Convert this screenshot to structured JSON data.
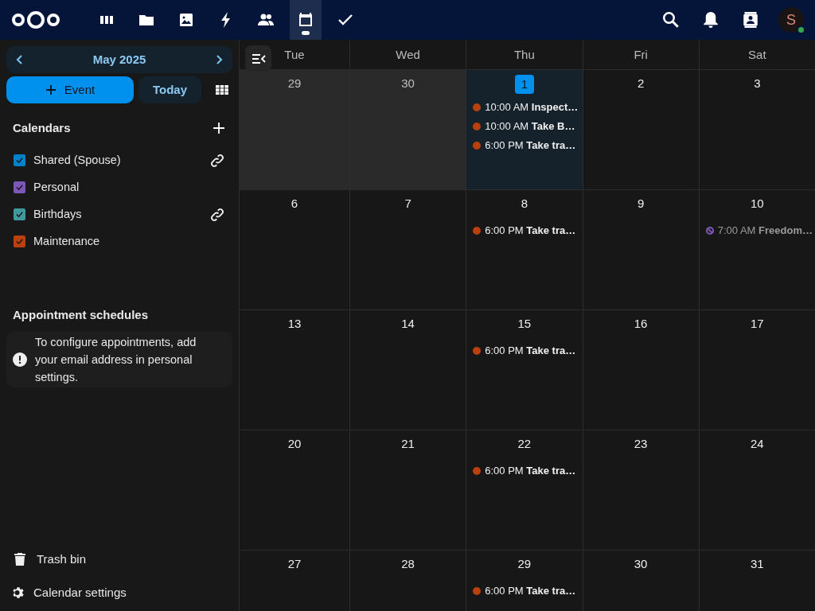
{
  "top_bar": {
    "apps": [
      {
        "kind": "dashboard",
        "selected": false
      },
      {
        "kind": "files",
        "selected": false
      },
      {
        "kind": "photos",
        "selected": false
      },
      {
        "kind": "activity",
        "selected": false
      },
      {
        "kind": "contacts",
        "selected": false
      },
      {
        "kind": "calendar",
        "selected": true
      },
      {
        "kind": "tasks",
        "selected": false
      }
    ],
    "avatar": "S"
  },
  "sidebar": {
    "month": "May 2025",
    "new_event": "Event",
    "today": "Today",
    "calendars_heading": "Calendars",
    "calendars": [
      {
        "name": "Shared (Spouse)",
        "color": "#0082c9",
        "checked": true,
        "shared": true
      },
      {
        "name": "Personal",
        "color": "#7b58b5",
        "checked": true,
        "shared": false
      },
      {
        "name": "Birthdays",
        "color": "#3e9a9c",
        "checked": true,
        "shared": true
      },
      {
        "name": "Maintenance",
        "color": "#b9400f",
        "checked": true,
        "shared": false
      }
    ],
    "appointments_heading": "Appointment schedules",
    "appointments_notice": "To configure appointments, add your email address in personal settings.",
    "trash": "Trash bin",
    "settings": "Calendar settings"
  },
  "calendar": {
    "columns": [
      "Tue",
      "Wed",
      "Thu",
      "Fri",
      "Sat"
    ],
    "weeks": [
      [
        {
          "day": "29",
          "other_month": true,
          "today": false
        },
        {
          "day": "30",
          "other_month": true,
          "today": false
        },
        {
          "day": "1",
          "other_month": false,
          "today": true,
          "events": [
            {
              "time": "10:00 AM",
              "title": "Inspect…",
              "color": "#b9400f",
              "kind": "normal"
            },
            {
              "time": "10:00 AM",
              "title": "Take B…",
              "color": "#b9400f",
              "kind": "normal"
            },
            {
              "time": "6:00 PM",
              "title": "Take tra…",
              "color": "#b9400f",
              "kind": "normal"
            }
          ]
        },
        {
          "day": "2",
          "other_month": false,
          "today": false
        },
        {
          "day": "3",
          "other_month": false,
          "today": false
        }
      ],
      [
        {
          "day": "6",
          "other_month": false,
          "today": false
        },
        {
          "day": "7",
          "other_month": false,
          "today": false
        },
        {
          "day": "8",
          "other_month": false,
          "today": false,
          "events": [
            {
              "time": "6:00 PM",
              "title": "Take tra…",
              "color": "#b9400f",
              "kind": "normal"
            }
          ]
        },
        {
          "day": "9",
          "other_month": false,
          "today": false
        },
        {
          "day": "10",
          "other_month": false,
          "today": false,
          "events": [
            {
              "time": "7:00 AM",
              "title": "Freedom…",
              "color": "#7b58b5",
              "kind": "cancelled"
            }
          ]
        }
      ],
      [
        {
          "day": "13",
          "other_month": false,
          "today": false
        },
        {
          "day": "14",
          "other_month": false,
          "today": false
        },
        {
          "day": "15",
          "other_month": false,
          "today": false,
          "events": [
            {
              "time": "6:00 PM",
              "title": "Take tra…",
              "color": "#b9400f",
              "kind": "normal"
            }
          ]
        },
        {
          "day": "16",
          "other_month": false,
          "today": false
        },
        {
          "day": "17",
          "other_month": false,
          "today": false
        }
      ],
      [
        {
          "day": "20",
          "other_month": false,
          "today": false
        },
        {
          "day": "21",
          "other_month": false,
          "today": false
        },
        {
          "day": "22",
          "other_month": false,
          "today": false,
          "events": [
            {
              "time": "6:00 PM",
              "title": "Take tra…",
              "color": "#b9400f",
              "kind": "normal"
            }
          ]
        },
        {
          "day": "23",
          "other_month": false,
          "today": false
        },
        {
          "day": "24",
          "other_month": false,
          "today": false
        }
      ],
      [
        {
          "day": "27",
          "other_month": false,
          "today": false
        },
        {
          "day": "28",
          "other_month": false,
          "today": false
        },
        {
          "day": "29",
          "other_month": false,
          "today": false,
          "events": [
            {
              "time": "6:00 PM",
              "title": "Take tra…",
              "color": "#b9400f",
              "kind": "normal"
            }
          ]
        },
        {
          "day": "30",
          "other_month": false,
          "today": false
        },
        {
          "day": "31",
          "other_month": false,
          "today": false
        }
      ]
    ]
  }
}
